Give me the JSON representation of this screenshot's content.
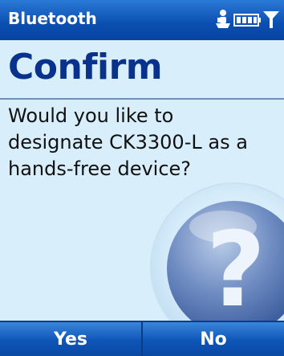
{
  "titlebar": {
    "app_title": "Bluetooth",
    "status_icons": [
      "connectivity-icon",
      "battery-icon",
      "signal-icon"
    ]
  },
  "dialog": {
    "heading": "Confirm",
    "message": "Would you like to designate CK3300-L as a hands-free device?",
    "graphic_icon": "question-mark-icon",
    "graphic_text": "?"
  },
  "softkeys": {
    "left_label": "Yes",
    "right_label": "No"
  },
  "colors": {
    "titlebar": "#0a4fb0",
    "content_bg": "#d8eefb",
    "heading": "#08328c",
    "softkey_bar": "#0d55b6"
  }
}
